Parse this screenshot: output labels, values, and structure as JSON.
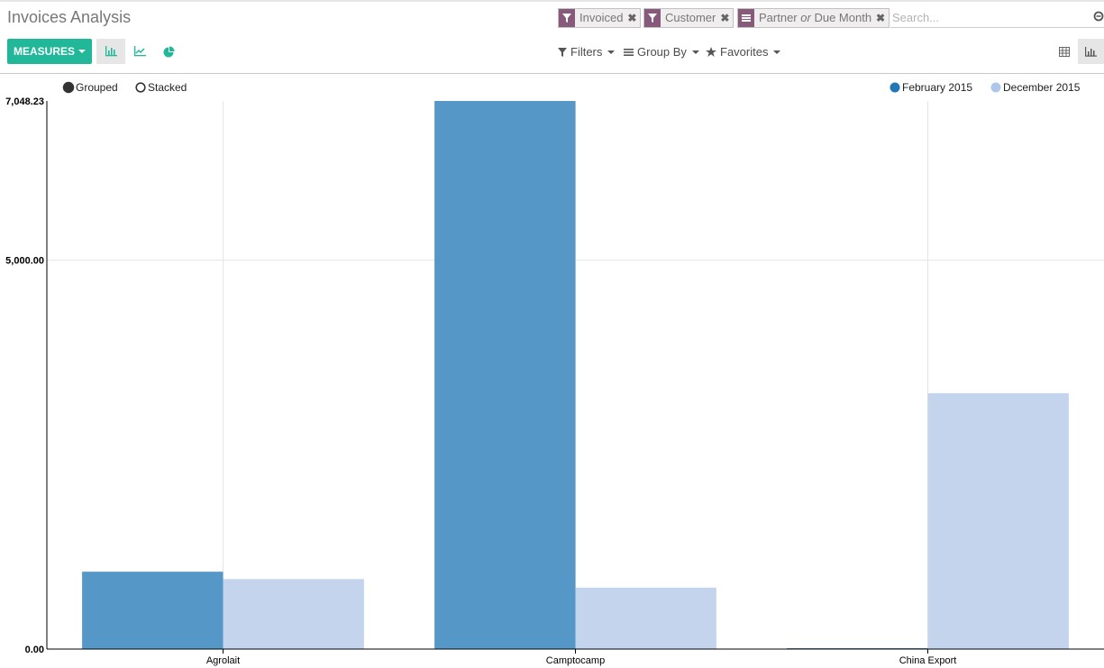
{
  "page": {
    "title": "Invoices Analysis"
  },
  "search": {
    "facets": [
      {
        "kind": "filter",
        "label": "Invoiced"
      },
      {
        "kind": "filter",
        "label": "Customer"
      },
      {
        "kind": "groupby",
        "label_a": "Partner",
        "joiner": "or",
        "label_b": "Due Month"
      }
    ],
    "placeholder": "Search..."
  },
  "toolbar": {
    "measures_label": "MEASURES",
    "filters_label": "Filters",
    "groupby_label": "Group By",
    "favorites_label": "Favorites"
  },
  "colors": {
    "accent": "#21b799",
    "facet": "#875a7b",
    "series_1": "#5598c7",
    "series_2": "#c3d4ec",
    "legend_1": "#1f77b4",
    "legend_2": "#aec7e8"
  },
  "icons": {
    "bar_chart_mode": "bar-chart-icon",
    "line_chart_mode": "line-chart-icon",
    "pie_chart_mode": "pie-chart-icon",
    "pivot_view": "table-grid-icon",
    "graph_view": "bar-chart-icon"
  },
  "chart_data": {
    "type": "bar",
    "mode_options": [
      {
        "label": "Grouped",
        "selected": true
      },
      {
        "label": "Stacked",
        "selected": false
      }
    ],
    "categories": [
      "Agrolait",
      "Camptocamp",
      "China Export"
    ],
    "series": [
      {
        "name": "February 2015",
        "values": [
          995,
          7048.23,
          8
        ]
      },
      {
        "name": "December 2015",
        "values": [
          900,
          790,
          3290
        ]
      }
    ],
    "yticks": [
      "0.00",
      "5,000.00",
      "7,048.23"
    ],
    "ytick_values": [
      0,
      5000,
      7048.23
    ],
    "ylim": [
      0,
      7048.23
    ],
    "legend_position": "top-right",
    "grid": true
  }
}
